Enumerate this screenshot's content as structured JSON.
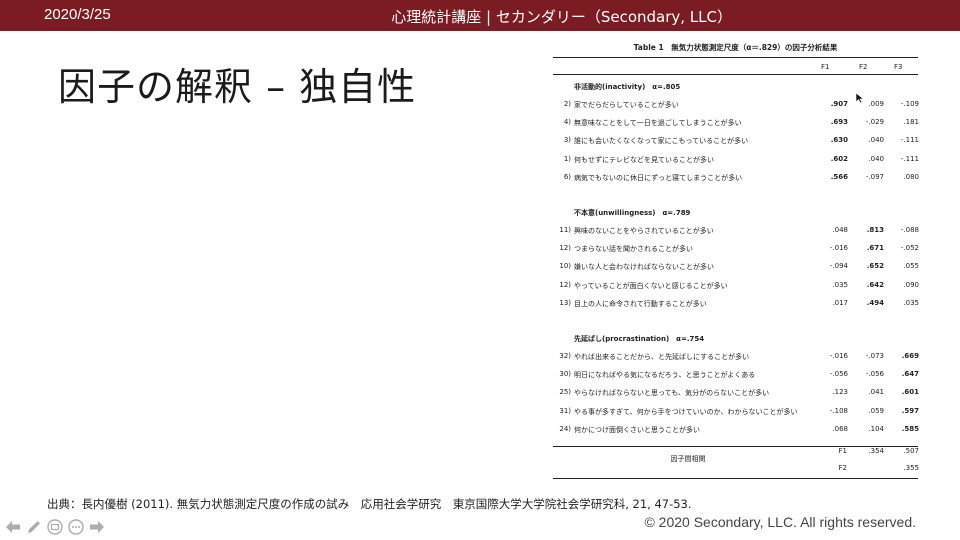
{
  "header": {
    "date": "2020/3/25",
    "course": "心理統計講座 | セカンダリー（Secondary, LLC）"
  },
  "slide": {
    "title": "因子の解釈 – 独自性",
    "source": "出典：長内優樹 (2011). 無気力状態測定尺度の作成の試み　応用社会学研究　東京国際大学大学院社会学研究科, 21, 47-53.",
    "copyright": "© 2020 Secondary, LLC. All rights reserved."
  },
  "table": {
    "caption": "Table 1　無気力状態測定尺度（α＝.829）の因子分析結果",
    "headers": [
      "F1",
      "F2",
      "F3"
    ],
    "sections": [
      {
        "title": "非活動的(inactivity)　α=.805",
        "rows": [
          {
            "id": "2)",
            "text": "家でだらだらしていることが多い",
            "f1": ".907",
            "f2": ".009",
            "f3": "-.109",
            "bold": 1
          },
          {
            "id": "4)",
            "text": "無意味なことをして一日を過ごしてしまうことが多い",
            "f1": ".693",
            "f2": "-.029",
            "f3": ".181",
            "bold": 1
          },
          {
            "id": "3)",
            "text": "誰にも会いたくなくなって家にこもっていることが多い",
            "f1": ".630",
            "f2": ".040",
            "f3": "-.111",
            "bold": 1
          },
          {
            "id": "1)",
            "text": "何もせずにテレビなどを見ていることが多い",
            "f1": ".602",
            "f2": ".040",
            "f3": "-.111",
            "bold": 1
          },
          {
            "id": "6)",
            "text": "病気でもないのに休日にずっと寝てしまうことが多い",
            "f1": ".566",
            "f2": "-.097",
            "f3": ".080",
            "bold": 1
          }
        ]
      },
      {
        "title": "不本意(unwillingness)　α=.789",
        "rows": [
          {
            "id": "11)",
            "text": "興味のないことをやらされていることが多い",
            "f1": ".048",
            "f2": ".813",
            "f3": "-.088",
            "bold": 2
          },
          {
            "id": "12)",
            "text": "つまらない話を聞かされることが多い",
            "f1": "-.016",
            "f2": ".671",
            "f3": "-.052",
            "bold": 2
          },
          {
            "id": "10)",
            "text": "嫌いな人と会わなければならないことが多い",
            "f1": "-.094",
            "f2": ".652",
            "f3": ".055",
            "bold": 2
          },
          {
            "id": "12)",
            "text": "やっていることが面白くないと感じることが多い",
            "f1": ".035",
            "f2": ".642",
            "f3": ".090",
            "bold": 2
          },
          {
            "id": "13)",
            "text": "目上の人に命令されて行動することが多い",
            "f1": ".017",
            "f2": ".494",
            "f3": ".035",
            "bold": 2
          }
        ]
      },
      {
        "title": "先延ばし(procrastination)　α=.754",
        "rows": [
          {
            "id": "32)",
            "text": "やれば出来ることだから、と先延ばしにすることが多い",
            "f1": "-.016",
            "f2": "-.073",
            "f3": ".669",
            "bold": 3
          },
          {
            "id": "30)",
            "text": "明日になればやる気になるだろう、と思うことがよくある",
            "f1": "-.056",
            "f2": "-.056",
            "f3": ".647",
            "bold": 3
          },
          {
            "id": "25)",
            "text": "やらなければならないと思っても、気分がのらないことが多い",
            "f1": ".123",
            "f2": ".041",
            "f3": ".601",
            "bold": 3
          },
          {
            "id": "31)",
            "text": "やる事が多すぎて、何から手をつけていいのか、わからないことが多い",
            "f1": "-.108",
            "f2": ".059",
            "f3": ".597",
            "bold": 3
          },
          {
            "id": "24)",
            "text": "何かにつけ面倒くさいと思うことが多い",
            "f1": ".068",
            "f2": ".104",
            "f3": ".585",
            "bold": 3
          }
        ]
      }
    ],
    "correlation": {
      "label": "因子間相関",
      "rows": [
        {
          "factor": "F1",
          "f2": ".354",
          "f3": ".507"
        },
        {
          "factor": "F2",
          "f2": "",
          "f3": ".355"
        }
      ]
    }
  },
  "nav": {
    "icons": [
      "arrow-left-icon",
      "pen-icon",
      "slides-icon",
      "more-icon",
      "arrow-right-icon"
    ]
  }
}
